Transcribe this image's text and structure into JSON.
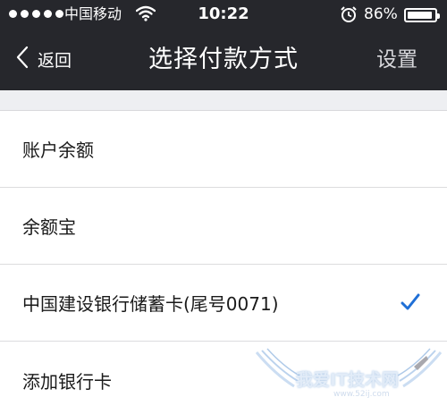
{
  "status_bar": {
    "carrier": "中国移动",
    "time": "10:22",
    "battery_percent": "86%",
    "battery_level": 0.86,
    "signal_dots": 5
  },
  "nav": {
    "back_label": "返回",
    "title": "选择付款方式",
    "settings_label": "设置"
  },
  "payment_methods": [
    {
      "label": "账户余额",
      "selected": false
    },
    {
      "label": "余额宝",
      "selected": false
    },
    {
      "label": "中国建设银行储蓄卡(尾号0071)",
      "selected": true
    },
    {
      "label": "添加银行卡",
      "selected": false
    }
  ],
  "watermark": {
    "text": "我爱IT技术网",
    "url": "www.52ij.com"
  },
  "icons": [
    "wifi-icon",
    "alarm-icon",
    "battery-icon",
    "back-chevron-icon",
    "checkmark-icon"
  ],
  "colors": {
    "header_bg": "#26272c",
    "accent_check": "#1f6fd6",
    "page_bg": "#eeeff2"
  }
}
